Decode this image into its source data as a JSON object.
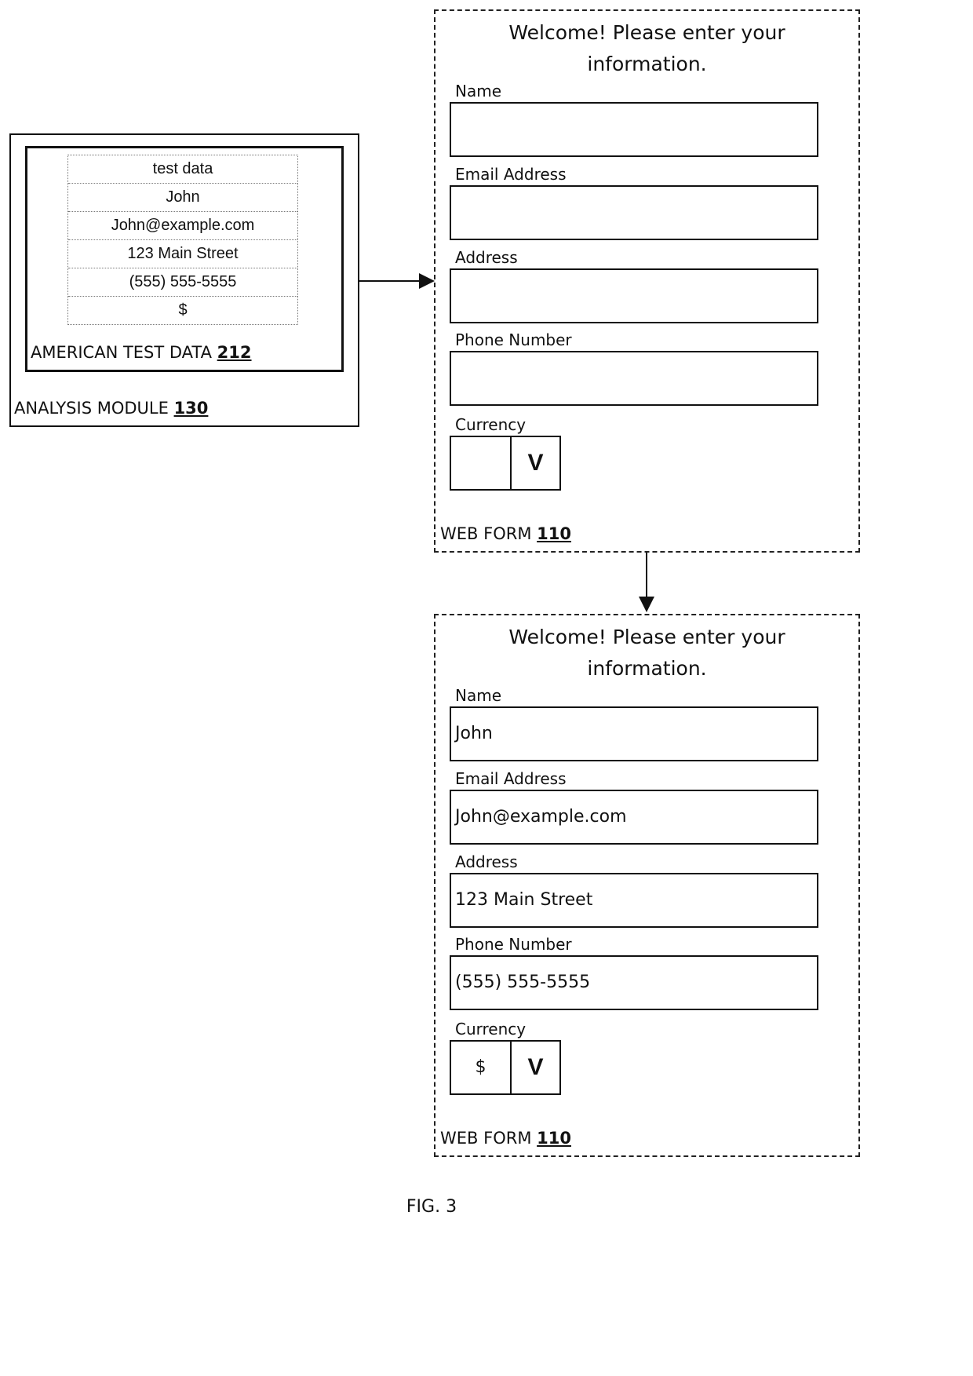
{
  "analysis_module": {
    "label": "ANALYSIS MODULE",
    "ref": "130"
  },
  "test_data": {
    "label": "AMERICAN TEST DATA",
    "ref": "212",
    "rows": [
      "test data",
      "John",
      "John@example.com",
      "123 Main Street",
      "(555) 555-5555",
      "$"
    ]
  },
  "form_empty": {
    "welcome_line1": "Welcome! Please enter your",
    "welcome_line2": "information.",
    "fields": [
      {
        "label": "Name",
        "value": ""
      },
      {
        "label": "Email Address",
        "value": ""
      },
      {
        "label": "Address",
        "value": ""
      },
      {
        "label": "Phone Number",
        "value": ""
      }
    ],
    "currency": {
      "label": "Currency",
      "value": "",
      "chevron": "V"
    },
    "footer_label": "WEB FORM",
    "footer_ref": "110"
  },
  "form_filled": {
    "welcome_line1": "Welcome! Please enter your",
    "welcome_line2": "information.",
    "fields": [
      {
        "label": "Name",
        "value": "John"
      },
      {
        "label": "Email Address",
        "value": "John@example.com"
      },
      {
        "label": "Address",
        "value": "123 Main Street"
      },
      {
        "label": "Phone Number",
        "value": "(555) 555-5555"
      }
    ],
    "currency": {
      "label": "Currency",
      "value": "$",
      "chevron": "V"
    },
    "footer_label": "WEB FORM",
    "footer_ref": "110"
  },
  "caption": "FIG. 3"
}
